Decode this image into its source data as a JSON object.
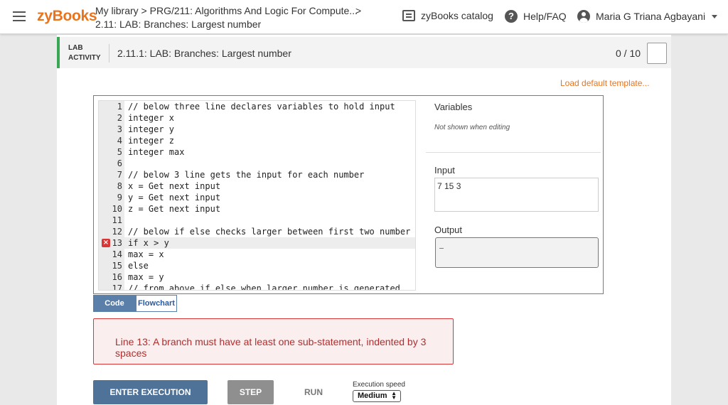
{
  "header": {
    "logo": "zyBooks",
    "breadcrumb_line1": "My library > PRG/211: Algorithms And Logic For Compute...",
    "breadcrumb_chevron": ">",
    "breadcrumb_line2": "2.11: LAB: Branches: Largest number",
    "catalog_label": "zyBooks catalog",
    "help_label": "Help/FAQ",
    "user_name": "Maria G Triana Agbayani"
  },
  "activity": {
    "type_line1": "LAB",
    "type_line2": "ACTIVITY",
    "title": "2.11.1: LAB: Branches: Largest number",
    "score": "0 / 10",
    "load_template": "Load default template..."
  },
  "editor": {
    "lines": [
      {
        "num": "1",
        "text": "// below three line declares variables to hold input"
      },
      {
        "num": "2",
        "text": "integer x"
      },
      {
        "num": "3",
        "text": "integer y"
      },
      {
        "num": "4",
        "text": "integer z"
      },
      {
        "num": "5",
        "text": "integer max"
      },
      {
        "num": "6",
        "text": ""
      },
      {
        "num": "7",
        "text": "// below 3 line gets the input for each number"
      },
      {
        "num": "8",
        "text": "x = Get next input"
      },
      {
        "num": "9",
        "text": "y = Get next input"
      },
      {
        "num": "10",
        "text": "z = Get next input"
      },
      {
        "num": "11",
        "text": ""
      },
      {
        "num": "12",
        "text": "// below if else checks larger between first two number"
      },
      {
        "num": "13",
        "text": "if x > y"
      },
      {
        "num": "14",
        "text": "max = x"
      },
      {
        "num": "15",
        "text": "else"
      },
      {
        "num": "16",
        "text": "max = y"
      },
      {
        "num": "17",
        "text": "// from above if else when larger number is generated"
      }
    ],
    "error_line_index": 12
  },
  "side": {
    "variables_title": "Variables",
    "variables_note": "Not shown when editing",
    "input_title": "Input",
    "input_value": "7 15 3",
    "output_title": "Output"
  },
  "tabs": {
    "code": "Code",
    "flowchart": "Flowchart"
  },
  "error": {
    "message": "Line 13: A branch must have at least one sub-statement, indented by 3 spaces"
  },
  "controls": {
    "enter_execution": "ENTER EXECUTION",
    "step": "STEP",
    "run": "RUN",
    "speed_label": "Execution speed",
    "speed_value": "Medium"
  },
  "colors": {
    "brand": "#e8741e",
    "activity_accent": "#3aa757",
    "error": "#d93636",
    "primary_button": "#4f7298"
  }
}
